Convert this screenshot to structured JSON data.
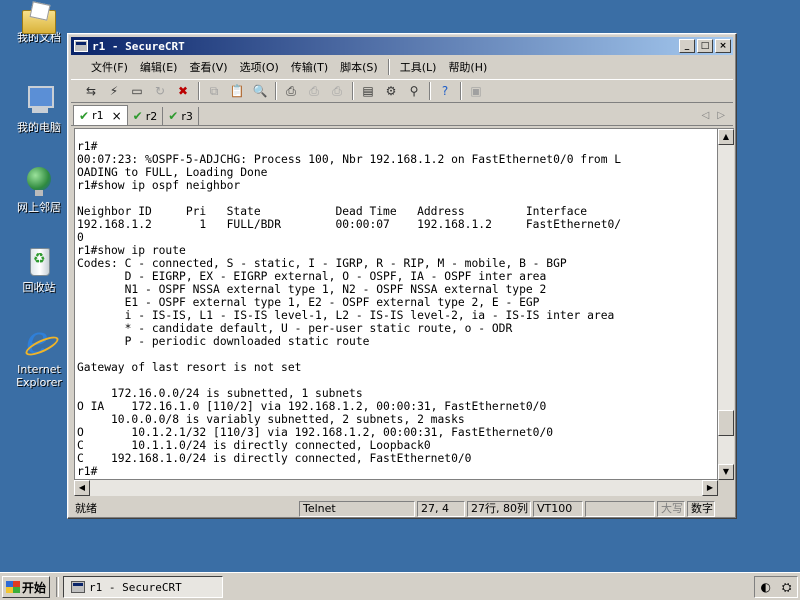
{
  "desktop": {
    "icons": [
      {
        "label": "我的文档"
      },
      {
        "label": "我的电脑"
      },
      {
        "label": "网上邻居"
      },
      {
        "label": "回收站"
      },
      {
        "label": "Internet Explorer"
      }
    ]
  },
  "window": {
    "title": "r1 - SecureCRT",
    "controls": {
      "minimize": "_",
      "maximize": "□",
      "close": "×"
    }
  },
  "menu": [
    "文件(F)",
    "编辑(E)",
    "查看(V)",
    "选项(O)",
    "传输(T)",
    "脚本(S)",
    "工具(L)",
    "帮助(H)"
  ],
  "toolbar": {
    "icons": [
      "connect-icon",
      "quick-connect-icon",
      "connect-tab-icon",
      "reconnect-icon",
      "disconnect-icon",
      "copy-icon",
      "paste-icon",
      "find-icon",
      "print-icon",
      "print-selection-icon",
      "print-setup-icon",
      "session-options-icon",
      "global-options-icon",
      "keymap-icon",
      "help-icon",
      "about-icon"
    ]
  },
  "tabs": [
    {
      "label": "r1",
      "active": true,
      "close": "×"
    },
    {
      "label": "r2",
      "active": false
    },
    {
      "label": "r3",
      "active": false
    }
  ],
  "terminal": {
    "lines": [
      "r1#",
      "00:07:23: %OSPF-5-ADJCHG: Process 100, Nbr 192.168.1.2 on FastEthernet0/0 from L",
      "OADING to FULL, Loading Done",
      "r1#show ip ospf neighbor",
      "",
      "Neighbor ID     Pri   State           Dead Time   Address         Interface",
      "192.168.1.2       1   FULL/BDR        00:00:07    192.168.1.2     FastEthernet0/",
      "0",
      "r1#show ip route",
      "Codes: C - connected, S - static, I - IGRP, R - RIP, M - mobile, B - BGP",
      "       D - EIGRP, EX - EIGRP external, O - OSPF, IA - OSPF inter area",
      "       N1 - OSPF NSSA external type 1, N2 - OSPF NSSA external type 2",
      "       E1 - OSPF external type 1, E2 - OSPF external type 2, E - EGP",
      "       i - IS-IS, L1 - IS-IS level-1, L2 - IS-IS level-2, ia - IS-IS inter area",
      "       * - candidate default, U - per-user static route, o - ODR",
      "       P - periodic downloaded static route",
      "",
      "Gateway of last resort is not set",
      "",
      "     172.16.0.0/24 is subnetted, 1 subnets",
      "O IA    172.16.1.0 [110/2] via 192.168.1.2, 00:00:31, FastEthernet0/0",
      "     10.0.0.0/8 is variably subnetted, 2 subnets, 2 masks",
      "O       10.1.2.1/32 [110/3] via 192.168.1.2, 00:00:31, FastEthernet0/0",
      "C       10.1.1.0/24 is directly connected, Loopback0",
      "C    192.168.1.0/24 is directly connected, FastEthernet0/0",
      "r1#"
    ],
    "scroll_position": 0.9
  },
  "status": {
    "ready": "就绪",
    "protocol": "Telnet",
    "cursor": "27,  4",
    "size": "27行, 80列",
    "emulation": "VT100",
    "caps": "大写",
    "num": "数字"
  },
  "taskbar": {
    "start": "开始",
    "task": "r1 - SecureCRT"
  }
}
